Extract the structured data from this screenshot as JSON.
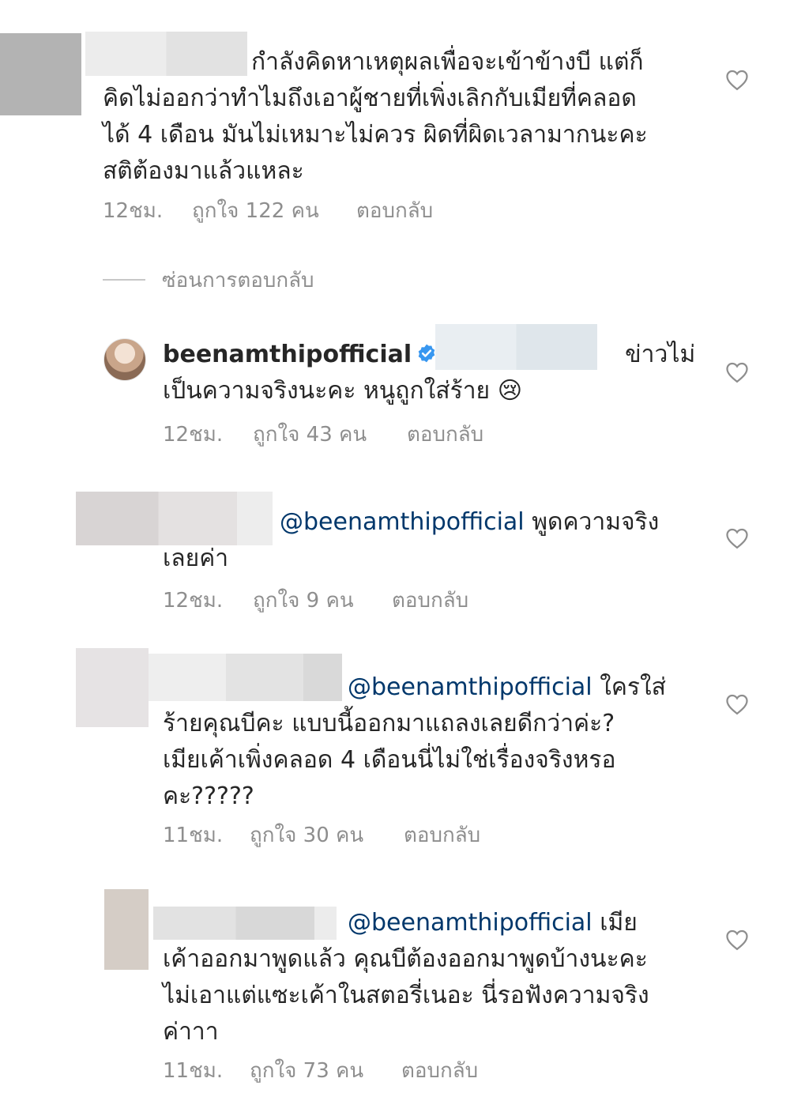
{
  "comments": [
    {
      "lines": [
        "กำลังคิดหาเหตุผลเพื่อจะเข้าข้างบี แต่ก็",
        "คิดไม่ออกว่าทำไมถึงเอาผู้ชายที่เพิ่งเลิกกับเมียที่คลอด",
        "ได้ 4 เดือน มันไม่เหมาะไม่ควร ผิดที่ผิดเวลามากนะคะ",
        "สติต้องมาแล้วแหละ"
      ],
      "time": "12ชม.",
      "likes": "ถูกใจ 122 คน",
      "reply": "ตอบกลับ"
    },
    {
      "hide_replies": "ซ่อนการตอบกลับ"
    },
    {
      "username": "beenamthipofficial",
      "line1_tail": "ข่าวไม่",
      "line2": "เป็นความจริงนะคะ หนูถูกใส่ร้าย",
      "emoji": "😢",
      "time": "12ชม.",
      "likes": "ถูกใจ 43 คน",
      "reply": "ตอบกลับ"
    },
    {
      "mention": "@beenamthipofficial",
      "line1_tail": "พูดความจริง",
      "line2": "เลยค่า",
      "time": "12ชม.",
      "likes": "ถูกใจ 9 คน",
      "reply": "ตอบกลับ"
    },
    {
      "mention": "@beenamthipofficial",
      "line1_tail": "ใครใส่",
      "lines_rest": [
        "ร้ายคุณบีคะ แบบนี้ออกมาแถลงเลยดีกว่าค่ะ?",
        "เมียเค้าเพิ่งคลอด 4 เดือนนี่ไม่ใช่เรื่องจริงหรอ",
        "คะ?????"
      ],
      "time": "11ชม.",
      "likes": "ถูกใจ 30 คน",
      "reply": "ตอบกลับ"
    },
    {
      "mention": "@beenamthipofficial",
      "line1_tail": "เมีย",
      "lines_rest": [
        "เค้าออกมาพูดแล้ว คุณบีต้องออกมาพูดบ้างนะคะ",
        "ไม่เอาแต่แซะเค้าในสตอรี่เนอะ นี่รอฟังความจริง",
        "ค่าาา"
      ],
      "time": "11ชม.",
      "likes": "ถูกใจ 73 คน",
      "reply": "ตอบกลับ"
    }
  ],
  "colors": {
    "text": "#262626",
    "meta": "#8e8e8e",
    "mention": "#00376b",
    "verified": "#3897f0"
  },
  "icons": {
    "like": "heart-outline-icon",
    "verified": "verified-badge-icon"
  }
}
